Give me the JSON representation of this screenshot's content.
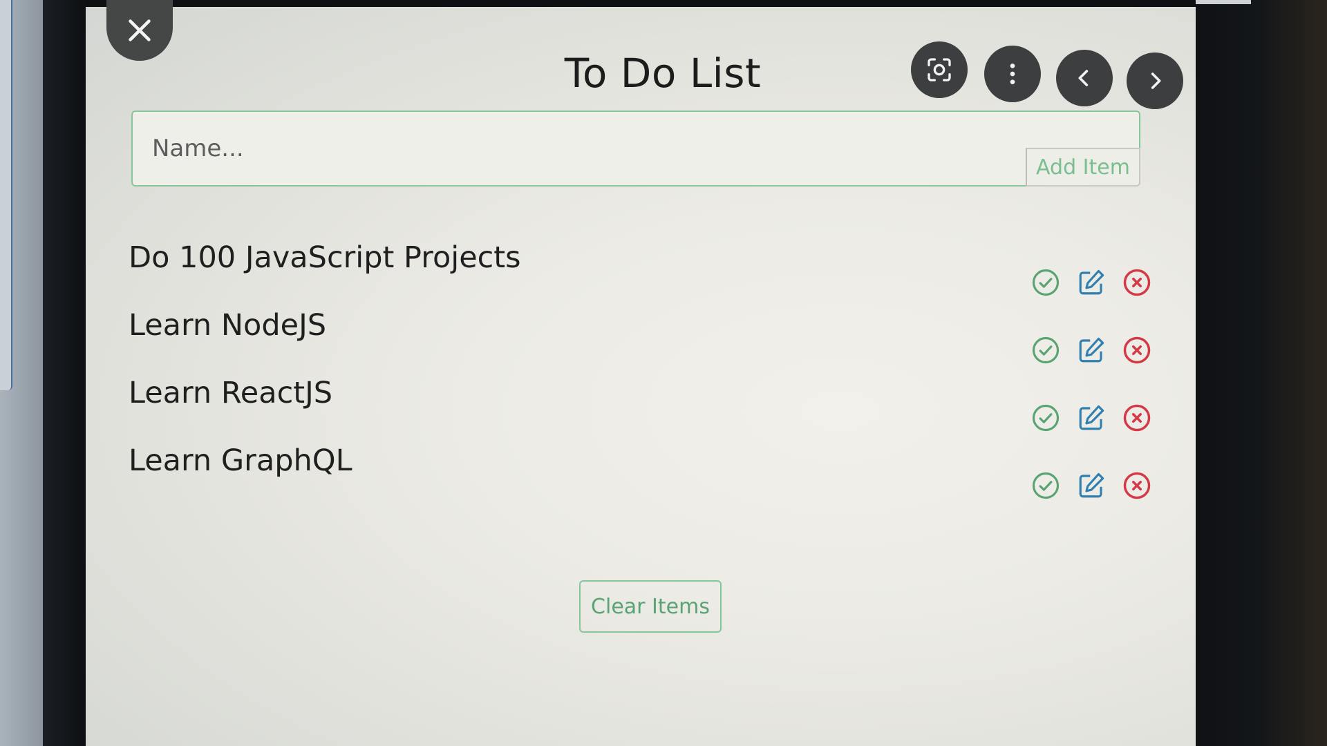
{
  "app": {
    "title": "To Do List"
  },
  "header": {
    "close_icon": "close-x-icon",
    "right_icons": [
      "scan-focus-icon",
      "more-vertical-icon",
      "chevron-left-icon",
      "chevron-right-icon"
    ]
  },
  "form": {
    "name_placeholder": "Name...",
    "name_value": "",
    "add_label": "Add Item"
  },
  "items": [
    {
      "label": "Do 100 JavaScript Projects"
    },
    {
      "label": "Learn NodeJS"
    },
    {
      "label": "Learn ReactJS"
    },
    {
      "label": "Learn GraphQL"
    }
  ],
  "actions": {
    "complete_icon": "check-circle-icon",
    "edit_icon": "edit-icon",
    "delete_icon": "x-circle-icon"
  },
  "footer": {
    "clear_label": "Clear Items"
  },
  "colors": {
    "accent_green": "#5aa474",
    "edit_blue": "#2f7fb0",
    "delete_red": "#d43a46",
    "round_button": "#3c3e3f"
  }
}
